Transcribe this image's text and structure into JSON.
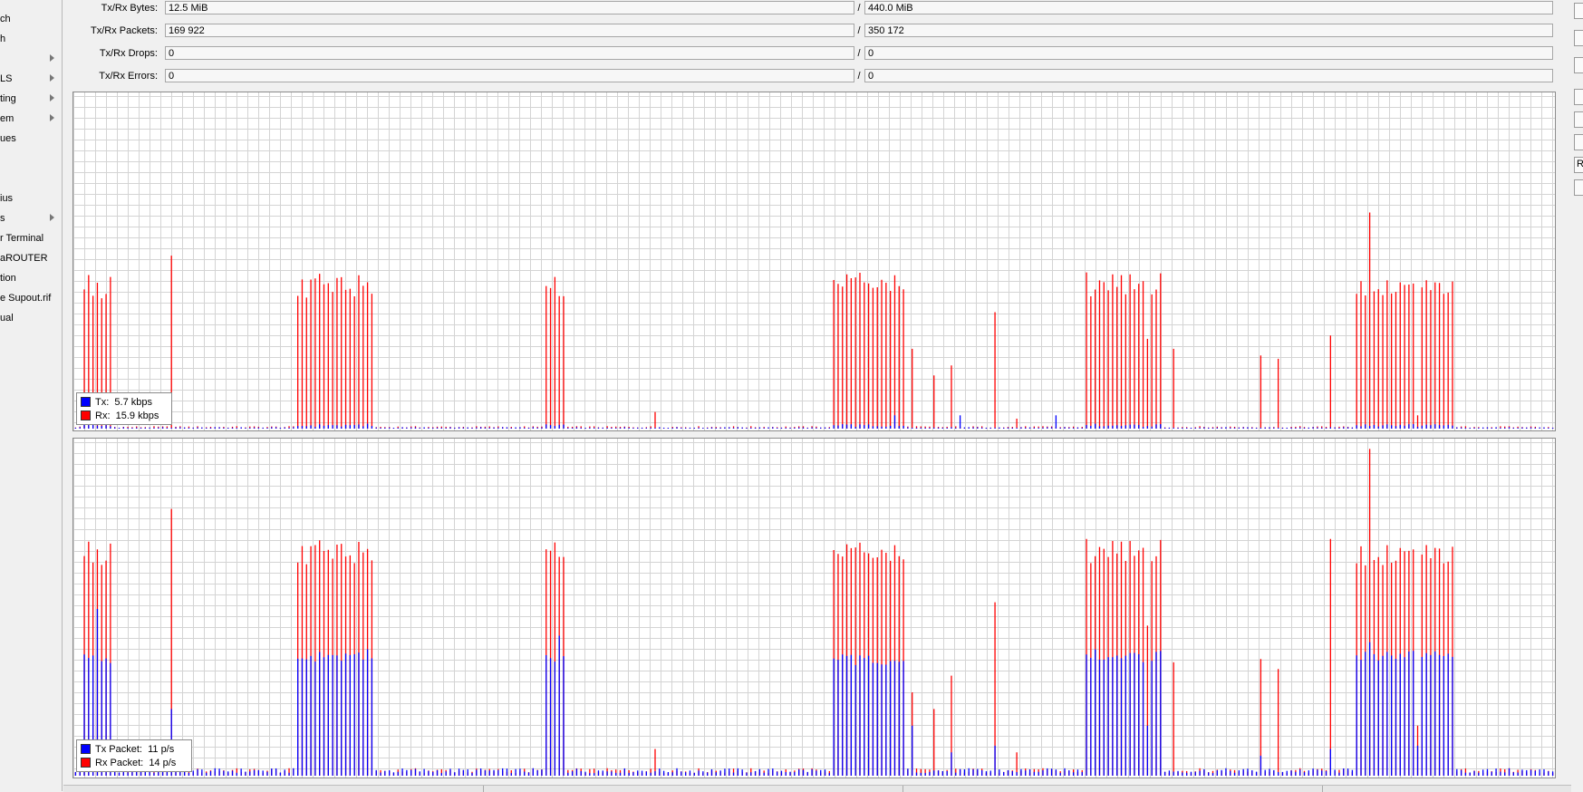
{
  "sidebar": {
    "items": [
      {
        "label": "ch",
        "submenu": false
      },
      {
        "label": "h",
        "submenu": false
      },
      {
        "label": "",
        "submenu": true
      },
      {
        "label": "LS",
        "submenu": true
      },
      {
        "label": "ting",
        "submenu": true
      },
      {
        "label": "em",
        "submenu": true
      },
      {
        "label": "ues",
        "submenu": false
      },
      {
        "label": "",
        "submenu": false
      },
      {
        "label": "",
        "submenu": false
      },
      {
        "label": "ius",
        "submenu": false
      },
      {
        "label": "s",
        "submenu": true
      },
      {
        "label": "r Terminal",
        "submenu": false
      },
      {
        "label": "aROUTER",
        "submenu": false
      },
      {
        "label": "tion",
        "submenu": false
      },
      {
        "label": "e Supout.rif",
        "submenu": false
      },
      {
        "label": "ual",
        "submenu": false
      }
    ]
  },
  "stats": {
    "bytes": {
      "label": "Tx/Rx Bytes:",
      "tx": "12.5 MiB",
      "rx": "440.0 MiB"
    },
    "packets": {
      "label": "Tx/Rx Packets:",
      "tx": "169 922",
      "rx": "350 172"
    },
    "drops": {
      "label": "Tx/Rx Drops:",
      "tx": "0",
      "rx": "0"
    },
    "errors": {
      "label": "Tx/Rx Errors:",
      "tx": "0",
      "rx": "0"
    },
    "separator": "/"
  },
  "traffic_graph": {
    "legend": [
      {
        "label": "Tx:",
        "value": "5.7 kbps",
        "color": "#0000ff"
      },
      {
        "label": "Rx:",
        "value": "15.9 kbps",
        "color": "#ff0000"
      }
    ]
  },
  "packet_graph": {
    "legend": [
      {
        "label": "Tx Packet:",
        "value": "11 p/s",
        "color": "#0000ff"
      },
      {
        "label": "Rx Packet:",
        "value": "14 p/s",
        "color": "#ff0000"
      }
    ]
  },
  "right_panel": {
    "buttons": [
      "",
      "",
      "",
      "",
      "",
      "",
      "R",
      ""
    ]
  },
  "colors": {
    "tx": "#0000ff",
    "rx": "#ff0000",
    "grid": "#d4d4d4"
  },
  "chart_data": [
    {
      "type": "bar",
      "title": "",
      "xlabel": "",
      "ylabel": "",
      "ylim": [
        0,
        100
      ],
      "grid": true,
      "legend_position": "bottom-left",
      "series": [
        {
          "name": "Tx",
          "color": "#0000ff",
          "bursts": [
            {
              "start": 0.3,
              "end": 2.5,
              "level": 1,
              "jitter": 0.5
            },
            {
              "start": 15,
              "end": 20,
              "level": 1,
              "jitter": 0.5
            },
            {
              "start": 31.5,
              "end": 33,
              "level": 1,
              "jitter": 0.5
            },
            {
              "start": 51,
              "end": 56,
              "level": 1,
              "jitter": 0.5
            },
            {
              "start": 68,
              "end": 73.5,
              "level": 1,
              "jitter": 0.5
            },
            {
              "start": 86.2,
              "end": 93.2,
              "level": 1,
              "jitter": 0.5
            }
          ],
          "spikes": [
            {
              "x": 55.4,
              "v": 4
            },
            {
              "x": 59.8,
              "v": 4
            },
            {
              "x": 66.2,
              "v": 4
            }
          ],
          "baseline": 0.3
        },
        {
          "name": "Rx",
          "color": "#ff0000",
          "bursts": [
            {
              "start": 0.3,
              "end": 2.5,
              "level": 43,
              "jitter": 4
            },
            {
              "start": 15,
              "end": 20,
              "level": 43,
              "jitter": 4
            },
            {
              "start": 31.5,
              "end": 33,
              "level": 43,
              "jitter": 4
            },
            {
              "start": 51,
              "end": 56,
              "level": 44,
              "jitter": 3
            },
            {
              "start": 68,
              "end": 73.5,
              "level": 43,
              "jitter": 4
            },
            {
              "start": 86.2,
              "end": 93.2,
              "level": 43,
              "jitter": 3
            }
          ],
          "spikes": [
            {
              "x": 6.5,
              "v": 52
            },
            {
              "x": 39,
              "v": 5
            },
            {
              "x": 56.6,
              "v": 24
            },
            {
              "x": 57.8,
              "v": 16
            },
            {
              "x": 59.2,
              "v": 19
            },
            {
              "x": 62,
              "v": 35
            },
            {
              "x": 63.5,
              "v": 3
            },
            {
              "x": 72.3,
              "v": 27
            },
            {
              "x": 74.2,
              "v": 24
            },
            {
              "x": 80,
              "v": 22
            },
            {
              "x": 81.3,
              "v": 21
            },
            {
              "x": 84.8,
              "v": 28
            },
            {
              "x": 87.3,
              "v": 65
            },
            {
              "x": 90.5,
              "v": 4
            }
          ],
          "baseline": 0.5
        }
      ]
    },
    {
      "type": "bar",
      "title": "",
      "xlabel": "",
      "ylabel": "",
      "ylim": [
        0,
        100
      ],
      "grid": true,
      "legend_position": "bottom-left",
      "series": [
        {
          "name": "Tx Packet",
          "color": "#0000ff",
          "bursts": [
            {
              "start": 0.3,
              "end": 2.5,
              "level": 35,
              "jitter": 2
            },
            {
              "start": 15,
              "end": 20,
              "level": 36,
              "jitter": 2
            },
            {
              "start": 31.5,
              "end": 33,
              "level": 35,
              "jitter": 2
            },
            {
              "start": 51,
              "end": 56,
              "level": 35,
              "jitter": 2
            },
            {
              "start": 68,
              "end": 73.5,
              "level": 36,
              "jitter": 2
            },
            {
              "start": 86.2,
              "end": 93.2,
              "level": 36,
              "jitter": 2
            }
          ],
          "spikes": [
            {
              "x": 1.4,
              "v": 50
            },
            {
              "x": 6.5,
              "v": 20
            },
            {
              "x": 32.7,
              "v": 42
            },
            {
              "x": 56.6,
              "v": 15
            },
            {
              "x": 59.2,
              "v": 7
            },
            {
              "x": 62,
              "v": 9
            },
            {
              "x": 72.3,
              "v": 15
            },
            {
              "x": 80,
              "v": 6
            },
            {
              "x": 84.8,
              "v": 8
            },
            {
              "x": 87.3,
              "v": 40
            },
            {
              "x": 90.5,
              "v": 9
            }
          ],
          "baseline": 1.5
        },
        {
          "name": "Rx Packet",
          "color": "#ff0000",
          "bursts": [
            {
              "start": 0.3,
              "end": 2.5,
              "level": 67,
              "jitter": 4
            },
            {
              "start": 15,
              "end": 20,
              "level": 67,
              "jitter": 4
            },
            {
              "start": 31.5,
              "end": 33,
              "level": 68,
              "jitter": 3
            },
            {
              "start": 51,
              "end": 56,
              "level": 67,
              "jitter": 3
            },
            {
              "start": 68,
              "end": 73.5,
              "level": 67,
              "jitter": 4
            },
            {
              "start": 86.2,
              "end": 93.2,
              "level": 67,
              "jitter": 4
            }
          ],
          "spikes": [
            {
              "x": 6.5,
              "v": 80
            },
            {
              "x": 39,
              "v": 8
            },
            {
              "x": 56.6,
              "v": 25
            },
            {
              "x": 57.8,
              "v": 20
            },
            {
              "x": 59.2,
              "v": 30
            },
            {
              "x": 62,
              "v": 52
            },
            {
              "x": 63.5,
              "v": 7
            },
            {
              "x": 72.3,
              "v": 45
            },
            {
              "x": 74.2,
              "v": 34
            },
            {
              "x": 80,
              "v": 35
            },
            {
              "x": 81.3,
              "v": 32
            },
            {
              "x": 84.8,
              "v": 71
            },
            {
              "x": 87.3,
              "v": 98
            },
            {
              "x": 90.5,
              "v": 15
            }
          ],
          "baseline": 1.5
        }
      ]
    }
  ]
}
